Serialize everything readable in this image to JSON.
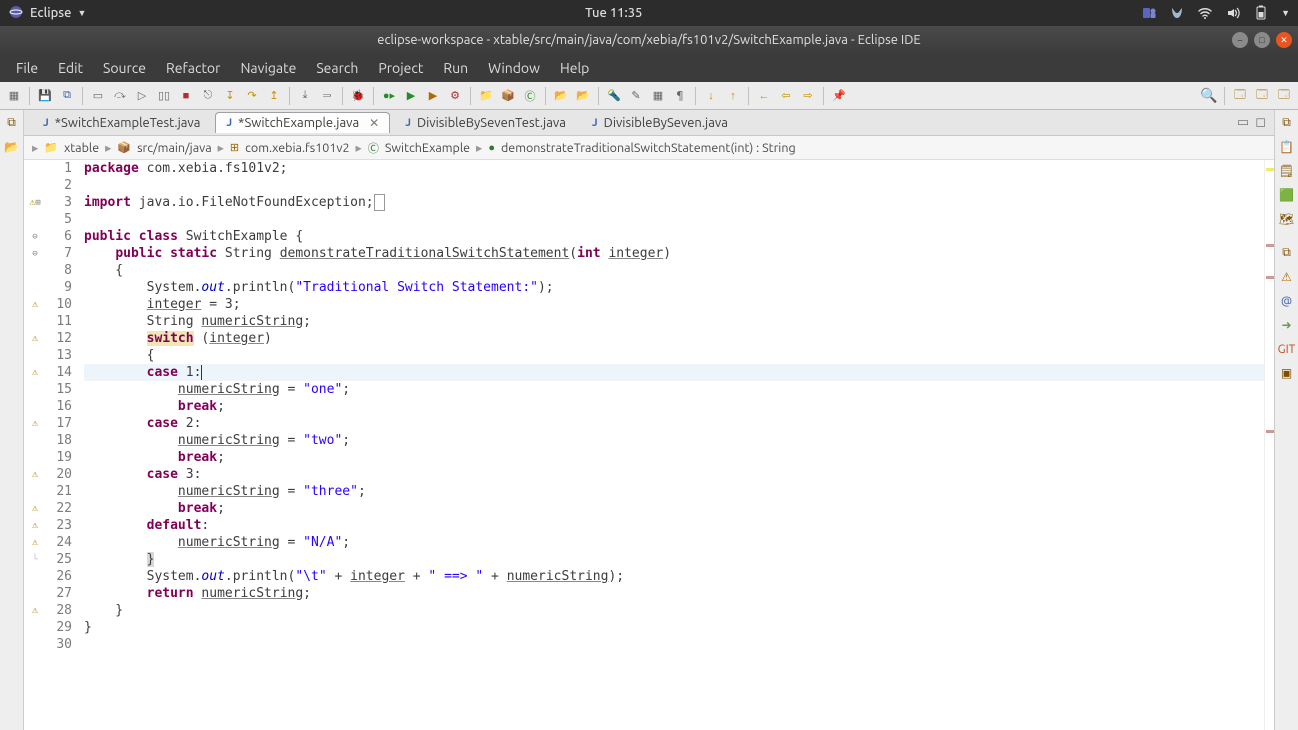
{
  "system": {
    "app_name": "Eclipse",
    "clock": "Tue 11:35"
  },
  "window": {
    "title": "eclipse-workspace - xtable/src/main/java/com/xebia/fs101v2/SwitchExample.java - Eclipse IDE"
  },
  "menu": {
    "items": [
      "File",
      "Edit",
      "Source",
      "Refactor",
      "Navigate",
      "Search",
      "Project",
      "Run",
      "Window",
      "Help"
    ]
  },
  "tabs": [
    {
      "label": "*SwitchExampleTest.java",
      "active": false
    },
    {
      "label": "*SwitchExample.java",
      "active": true,
      "closable": true
    },
    {
      "label": "DivisibleBySevenTest.java",
      "active": false
    },
    {
      "label": "DivisibleBySeven.java",
      "active": false
    }
  ],
  "breadcrumb": {
    "project": "xtable",
    "source_folder": "src/main/java",
    "package": "com.xebia.fs101v2",
    "class": "SwitchExample",
    "method": "demonstrateTraditionalSwitchStatement(int) : String"
  },
  "code": {
    "package_line": "com.xebia.fs101v2",
    "import_line": "java.io.FileNotFoundException",
    "class_name": "SwitchExample",
    "method_name": "demonstrateTraditionalSwitchStatement",
    "param_type": "int",
    "param_name": "integer",
    "return_type": "String",
    "println1": "\"Traditional Switch Statement:\"",
    "assign_int": "integer = 3;",
    "decl_str": "String numericString;",
    "case1_val": "\"one\"",
    "case2_val": "\"two\"",
    "case3_val": "\"three\"",
    "default_val": "\"N/A\"",
    "println2_a": "\"\\t\"",
    "println2_b": "\" ==> \"",
    "first_line": 1,
    "last_line": 30,
    "highlight_line": 14,
    "boxed_line": 25
  }
}
